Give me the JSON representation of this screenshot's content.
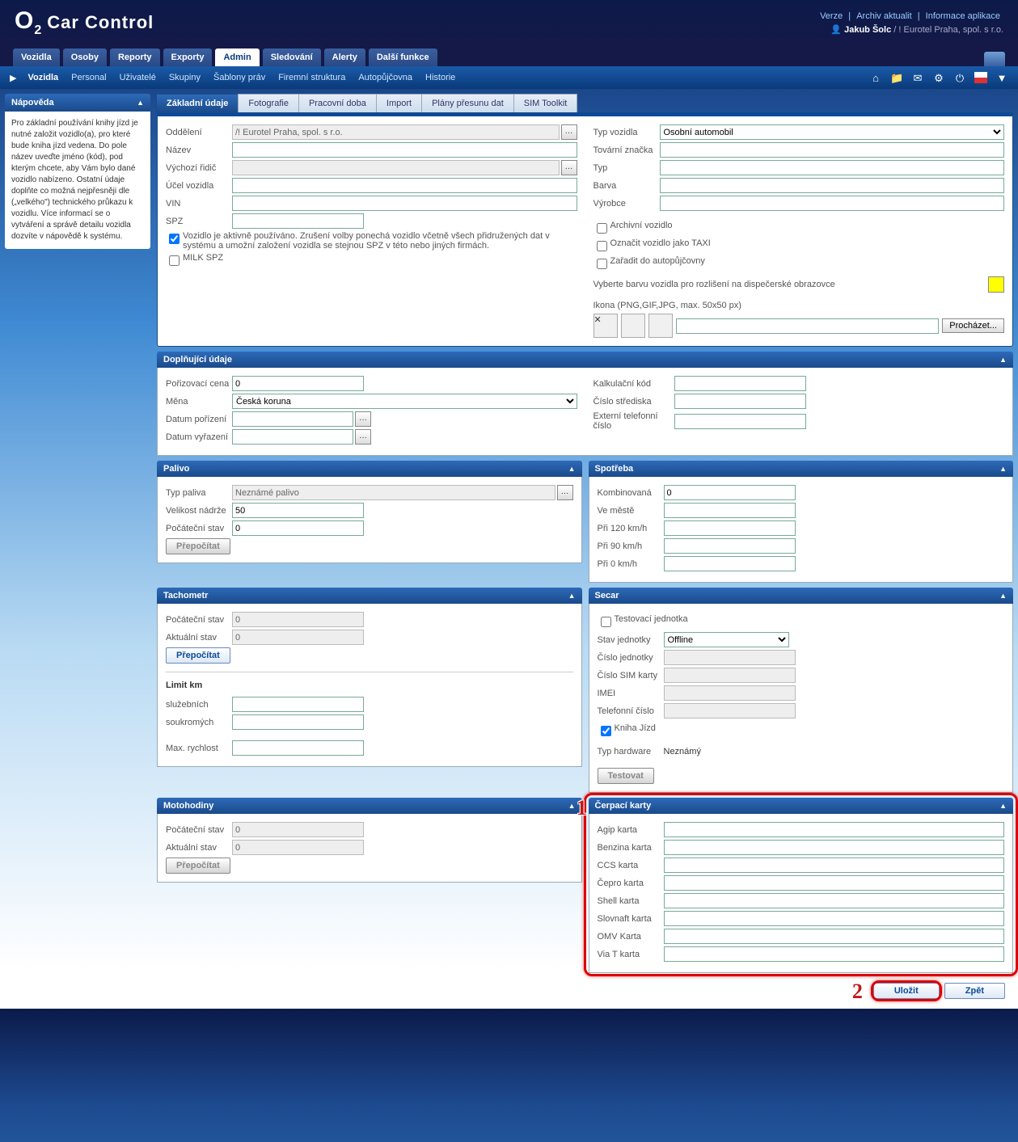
{
  "app_title": "Car Control",
  "top_links": [
    "Verze",
    "Archiv aktualit",
    "Informace aplikace"
  ],
  "user_name": "Jakub Šolc",
  "user_org": "! Eurotel Praha, spol. s r.o.",
  "main_tabs": [
    "Vozidla",
    "Osoby",
    "Reporty",
    "Exporty",
    "Admin",
    "Sledování",
    "Alerty",
    "Další funkce"
  ],
  "main_active": 4,
  "sub_tabs": [
    "Vozidla",
    "Personal",
    "Uživatelé",
    "Skupiny",
    "Šablony práv",
    "Firemní struktura",
    "Autopůjčovna",
    "Historie"
  ],
  "sub_active": 0,
  "help_title": "Nápověda",
  "help_text": "Pro základní používání knihy jízd je nutné založit vozidlo(a), pro které bude kniha jízd vedena. Do pole název uveďte jméno (kód), pod kterým chcete, aby Vám bylo dané vozidlo nabízeno. Ostatní údaje doplňte co možná nejpřesněji dle („velkého\") technického průkazu k vozidlu. Více informací se o vytváření a správě detailu vozidla dozvíte v nápovědě k systému.",
  "form_tabs": [
    "Základní údaje",
    "Fotografie",
    "Pracovní doba",
    "Import",
    "Plány přesunu dat",
    "SIM Toolkit"
  ],
  "form_active": 0,
  "basic": {
    "oddeleni_lbl": "Oddělení",
    "oddeleni_val": "/! Eurotel Praha, spol. s r.o.",
    "nazev_lbl": "Název",
    "vychozi_lbl": "Výchozí řidič",
    "ucel_lbl": "Účel vozidla",
    "vin_lbl": "VIN",
    "spz_lbl": "SPZ",
    "chk_active": "Vozidlo je aktivně používáno. Zrušení volby ponechá vozidlo včetně všech přidružených dat v systému a umožní založení vozidla se stejnou SPZ v této nebo jiných firmách.",
    "chk_milk": "MILK SPZ",
    "typv_lbl": "Typ vozidla",
    "typv_val": "Osobní automobil",
    "tovzn_lbl": "Tovární značka",
    "typ_lbl": "Typ",
    "barva_lbl": "Barva",
    "vyrobce_lbl": "Výrobce",
    "chk_arch": "Archivní vozidlo",
    "chk_taxi": "Označit vozidlo jako TAXI",
    "chk_pujc": "Zařadit do autopůjčovny",
    "color_txt": "Vyberte barvu vozidla pro rozlišení na dispečerské obrazovce",
    "ikona_txt": "Ikona (PNG,GIF,JPG, max. 50x50 px)",
    "browse": "Procházet..."
  },
  "dop": {
    "hdr": "Doplňující údaje",
    "pcena": "Pořizovací cena",
    "pcena_v": "0",
    "mena": "Měna",
    "mena_v": "Česká koruna",
    "dpor": "Datum pořízení",
    "dvyr": "Datum vyřazení",
    "kalk": "Kalkulační kód",
    "cstr": "Číslo střediska",
    "extt": "Externí telefonní číslo"
  },
  "palivo": {
    "hdr": "Palivo",
    "typ": "Typ paliva",
    "typ_v": "Neznámé palivo",
    "vel": "Velikost nádrže",
    "vel_v": "50",
    "poc": "Počáteční stav",
    "poc_v": "0",
    "btn": "Přepočítat"
  },
  "spotreba": {
    "hdr": "Spotřeba",
    "komb": "Kombinovaná",
    "komb_v": "0",
    "mesto": "Ve městě",
    "p120": "Při 120 km/h",
    "p90": "Při 90 km/h",
    "p0": "Při 0 km/h"
  },
  "tacho": {
    "hdr": "Tachometr",
    "poc": "Počáteční stav",
    "poc_v": "0",
    "akt": "Aktuální stav",
    "akt_v": "0",
    "btn": "Přepočítat",
    "limit": "Limit km",
    "sluz": "služebních",
    "souk": "soukromých",
    "max": "Max. rychlost"
  },
  "secar": {
    "hdr": "Secar",
    "test": "Testovací jednotka",
    "stav": "Stav jednotky",
    "stav_v": "Offline",
    "cjed": "Číslo jednotky",
    "csim": "Číslo SIM karty",
    "imei": "IMEI",
    "tel": "Telefonní číslo",
    "kj": "Kniha Jízd",
    "thw": "Typ hardware",
    "thw_v": "Neznámý",
    "btn": "Testovat"
  },
  "moto": {
    "hdr": "Motohodiny",
    "poc": "Počáteční stav",
    "poc_v": "0",
    "akt": "Aktuální stav",
    "akt_v": "0",
    "btn": "Přepočítat"
  },
  "karty": {
    "hdr": "Čerpací karty",
    "items": [
      "Agip karta",
      "Benzina karta",
      "CCS karta",
      "Čepro karta",
      "Shell karta",
      "Slovnaft karta",
      "OMV Karta",
      "Via T karta"
    ]
  },
  "footer": {
    "save": "Uložit",
    "back": "Zpět"
  },
  "annot": {
    "n1": "1",
    "n2": "2"
  }
}
